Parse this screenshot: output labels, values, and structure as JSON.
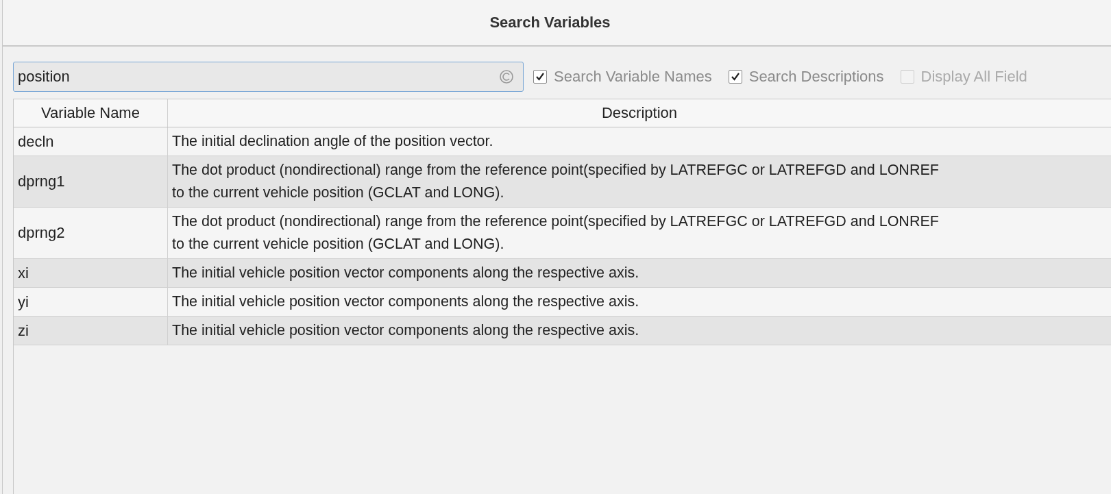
{
  "window": {
    "title": "Search Variables"
  },
  "search": {
    "value": "position"
  },
  "options": [
    {
      "label": "Search Variable Names",
      "checked": true,
      "disabled": false
    },
    {
      "label": "Search Descriptions",
      "checked": true,
      "disabled": false
    },
    {
      "label": "Display All Field",
      "checked": false,
      "disabled": true
    }
  ],
  "table": {
    "columns": [
      "Variable Name",
      "Description"
    ],
    "rows": [
      {
        "name": "decln",
        "description": [
          "The initial declination angle of the position vector."
        ]
      },
      {
        "name": "dprng1",
        "description": [
          "The dot product (nondirectional) range from the reference point(specified by LATREFGC or LATREFGD and LONREF",
          "to the current vehicle position (GCLAT and LONG)."
        ]
      },
      {
        "name": "dprng2",
        "description": [
          "The dot product (nondirectional) range from the reference point(specified by LATREFGC or LATREFGD and LONREF",
          "to the current vehicle position (GCLAT and LONG)."
        ]
      },
      {
        "name": "xi",
        "description": [
          "The initial vehicle position vector components along the respective axis."
        ]
      },
      {
        "name": "yi",
        "description": [
          "The initial vehicle position vector components along the respective axis."
        ]
      },
      {
        "name": "zi",
        "description": [
          "The initial vehicle position vector components along the respective axis."
        ]
      }
    ]
  }
}
